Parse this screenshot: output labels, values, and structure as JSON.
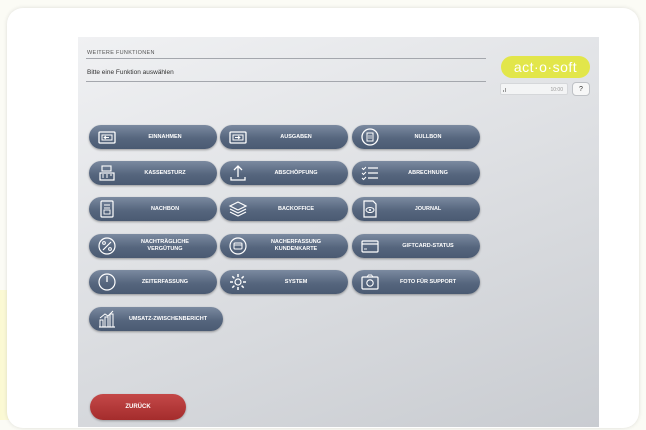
{
  "header": {
    "title": "WEITERE FUNKTIONEN",
    "subtitle": "Bitte eine Funktion auswählen"
  },
  "logo": {
    "text": "act·o·soft",
    "color": "#e2e64a"
  },
  "status": {
    "time": "10:00"
  },
  "help": {
    "label": "?"
  },
  "functions": [
    {
      "label": "EINNAHMEN",
      "icon": "cash-in-icon"
    },
    {
      "label": "AUSGABEN",
      "icon": "cash-out-icon"
    },
    {
      "label": "NULLBON",
      "icon": "null-receipt-icon"
    },
    {
      "label": "KASSENSTURZ",
      "icon": "cash-register-icon"
    },
    {
      "label": "ABSCHÖPFUNG",
      "icon": "upload-arrow-icon"
    },
    {
      "label": "ABRECHNUNG",
      "icon": "checklist-icon"
    },
    {
      "label": "NACHBON",
      "icon": "receipt-icon"
    },
    {
      "label": "BACKOFFICE",
      "icon": "layers-icon"
    },
    {
      "label": "JOURNAL",
      "icon": "document-eye-icon"
    },
    {
      "label": "NACHTRÄGLICHE\nVERGÜTUNG",
      "icon": "percent-icon"
    },
    {
      "label": "NACHERFASSUNG\nKUNDENKARTE",
      "icon": "customer-card-icon"
    },
    {
      "label": "GIFTCARD-STATUS",
      "icon": "gift-card-icon"
    },
    {
      "label": "ZEITERFASSUNG",
      "icon": "clock-icon"
    },
    {
      "label": "SYSTEM",
      "icon": "gear-icon"
    },
    {
      "label": "FOTO FÜR SUPPORT",
      "icon": "camera-icon"
    },
    {
      "label": "UMSATZ-ZWISCHENBERICHT",
      "icon": "bar-chart-icon"
    }
  ],
  "back": {
    "label": "ZURÜCK",
    "color": "#b83a3a"
  }
}
